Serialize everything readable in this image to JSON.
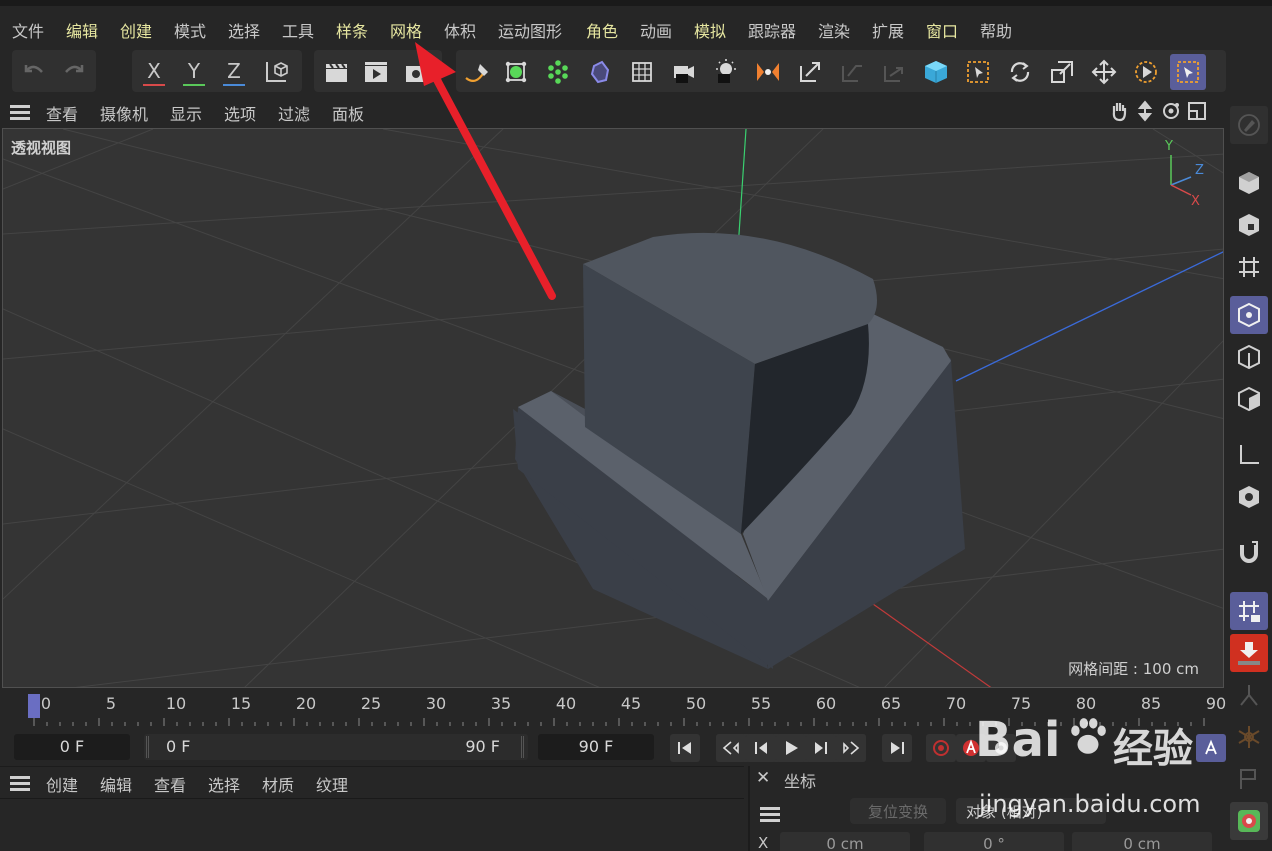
{
  "menu": {
    "items": [
      {
        "label": "文件",
        "hl": false
      },
      {
        "label": "编辑",
        "hl": true
      },
      {
        "label": "创建",
        "hl": true
      },
      {
        "label": "模式",
        "hl": false
      },
      {
        "label": "选择",
        "hl": false
      },
      {
        "label": "工具",
        "hl": false
      },
      {
        "label": "样条",
        "hl": true
      },
      {
        "label": "网格",
        "hl": true
      },
      {
        "label": "体积",
        "hl": false
      },
      {
        "label": "运动图形",
        "hl": false
      },
      {
        "label": "角色",
        "hl": true
      },
      {
        "label": "动画",
        "hl": false
      },
      {
        "label": "模拟",
        "hl": true
      },
      {
        "label": "跟踪器",
        "hl": false
      },
      {
        "label": "渲染",
        "hl": false
      },
      {
        "label": "扩展",
        "hl": false
      },
      {
        "label": "窗口",
        "hl": true
      },
      {
        "label": "帮助",
        "hl": false
      }
    ]
  },
  "toolbar": {
    "axis_x": "X",
    "axis_y": "Y",
    "axis_z": "Z",
    "icon_colors": {
      "x": "#d84a4a",
      "y": "#5ac85a",
      "z": "#4a8ad8",
      "green": "#58d858",
      "orange": "#f0a030",
      "cyan": "#48c8e8",
      "accent": "#5a5e9a"
    }
  },
  "viewport_menu": {
    "items": [
      "查看",
      "摄像机",
      "显示",
      "选项",
      "过滤",
      "面板"
    ]
  },
  "viewport": {
    "label": "透视视图",
    "grid_spacing": "网格间距 : 100 cm",
    "gizmo": {
      "y": "Y",
      "z": "Z",
      "x": "X"
    }
  },
  "timeline": {
    "ticks": [
      "0",
      "5",
      "10",
      "15",
      "20",
      "25",
      "30",
      "35",
      "40",
      "45",
      "50",
      "55",
      "60",
      "65",
      "70",
      "75",
      "80",
      "85",
      "90"
    ],
    "current_frame": 0
  },
  "transport": {
    "current": "0 F",
    "range_start": "0 F",
    "range_end": "90 F",
    "end": "90 F"
  },
  "material_panel": {
    "items": [
      "创建",
      "编辑",
      "查看",
      "选择",
      "材质",
      "纹理"
    ]
  },
  "coord_panel": {
    "title": "坐标",
    "reset_btn": "复位变换",
    "mode": "对象 (相对)",
    "row_x_label": "X",
    "row_x_pos": "0 cm",
    "row_x_rot": "0 °",
    "row_x_size": "0 cm"
  },
  "watermark": {
    "brand": "Bai",
    "brand2": "经验",
    "url": "jingyan.baidu.com"
  }
}
